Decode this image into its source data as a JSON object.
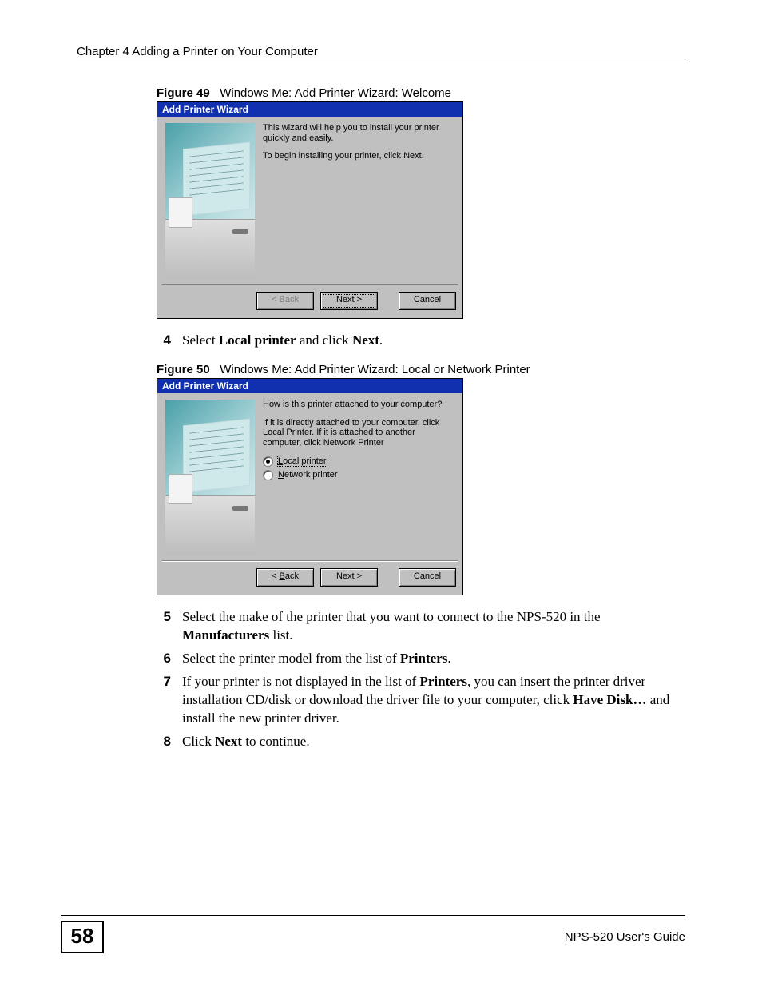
{
  "header": {
    "chapter": "Chapter 4 Adding a Printer on Your Computer"
  },
  "figure49": {
    "label": "Figure 49",
    "caption": "Windows Me: Add Printer Wizard: Welcome",
    "title": "Add Printer Wizard",
    "line1": "This wizard will help you to install your printer quickly and easily.",
    "line2": "To begin installing your printer, click Next.",
    "buttons": {
      "back": "< Back",
      "next": "Next >",
      "cancel": "Cancel"
    }
  },
  "step4": {
    "num": "4",
    "pre": "Select ",
    "bold1": "Local printer",
    "mid": " and click ",
    "bold2": "Next",
    "post": "."
  },
  "figure50": {
    "label": "Figure 50",
    "caption": "Windows Me: Add Printer Wizard: Local or Network Printer",
    "title": "Add Printer Wizard",
    "q": "How is this printer attached to your computer?",
    "hint": "If it is directly attached to your computer, click Local Printer. If it is attached to another computer, click Network Printer",
    "radio_local_prefix": "L",
    "radio_local_rest": "ocal printer",
    "radio_net_prefix": "N",
    "radio_net_rest": "etwork printer",
    "buttons": {
      "back": "< Back",
      "next": "Next >",
      "cancel": "Cancel"
    }
  },
  "step5": {
    "num": "5",
    "pre": "Select the make of the printer that you want to connect to the NPS-520 in the ",
    "bold1": "Manufacturers",
    "post": " list."
  },
  "step6": {
    "num": "6",
    "pre": "Select the printer model from the list of ",
    "bold1": "Printers",
    "post": "."
  },
  "step7": {
    "num": "7",
    "pre": "If your printer is not displayed in the list of ",
    "bold1": "Printers",
    "mid": ", you can insert the printer driver installation CD/disk or download the driver file to your computer, click ",
    "bold2": "Have Disk…",
    "post": " and install the new printer driver."
  },
  "step8": {
    "num": "8",
    "pre": "Click ",
    "bold1": "Next",
    "post": " to continue."
  },
  "footer": {
    "page": "58",
    "guide": "NPS-520 User's Guide"
  }
}
